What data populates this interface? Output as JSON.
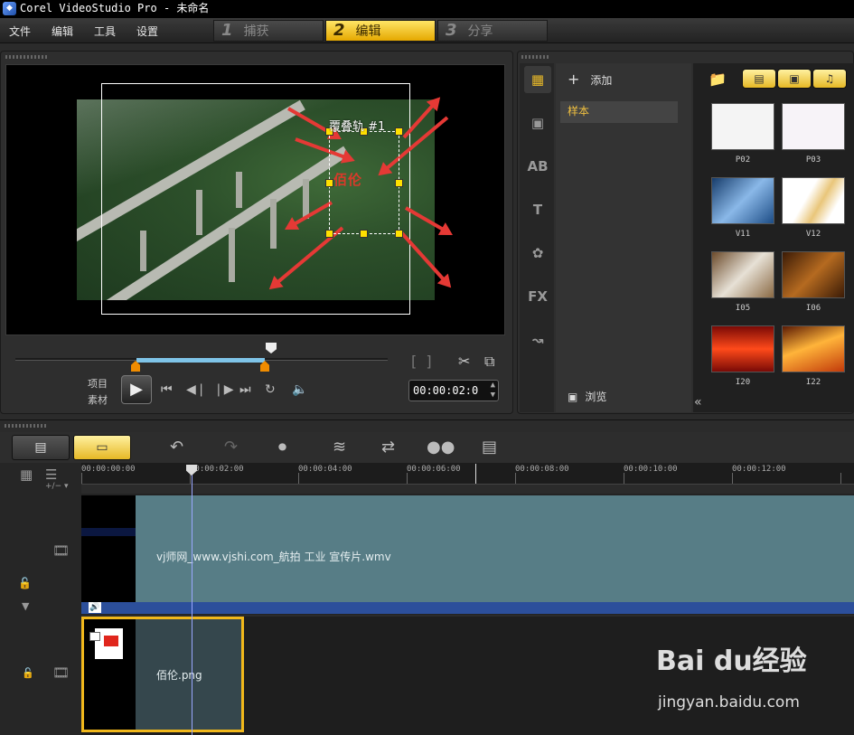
{
  "window": {
    "title": "Corel VideoStudio Pro - 未命名"
  },
  "menu": {
    "items": [
      "文件",
      "编辑",
      "工具",
      "设置"
    ]
  },
  "steps": [
    {
      "num": "1",
      "label": "捕获"
    },
    {
      "num": "2",
      "label": "编辑",
      "active": true
    },
    {
      "num": "3",
      "label": "分享"
    }
  ],
  "preview": {
    "overlay_label": "覆叠轨 #1",
    "overlay_logo_text": "佰伦",
    "mode_labels": [
      "项目",
      "素材"
    ],
    "timecode": "00:00:02:0"
  },
  "library": {
    "add_label": "添加",
    "folder": "样本",
    "browse_label": "浏览",
    "tabs": [
      "media",
      "transition",
      "AB",
      "T",
      "graphic",
      "FX",
      "path"
    ],
    "thumbs": [
      {
        "label": "P02",
        "color": "#f4f4f4"
      },
      {
        "label": "P03",
        "color": "#f7f3f8"
      },
      {
        "label": "V11",
        "color": "#3a6fa6"
      },
      {
        "label": "V12",
        "color": "#f5ecd8"
      },
      {
        "label": "I05",
        "color": "#b58c62"
      },
      {
        "label": "I06",
        "color": "#8a4a18"
      },
      {
        "label": "I20",
        "color": "#c2201a"
      },
      {
        "label": "I22",
        "color": "#e08a1a"
      }
    ]
  },
  "timeline": {
    "ticks": [
      "00:00:00:00",
      "00:00:02:00",
      "00:00:04:00",
      "00:00:06:00",
      "00:00:08:00",
      "00:00:10:00",
      "00:00:12:00"
    ],
    "video_clip_name": "vj师网_www.vjshi.com_航拍 工业 宣传片.wmv",
    "overlay_clip_name": "佰伦.png"
  },
  "watermark": {
    "text": "Bai du经验",
    "url": "jingyan.baidu.com"
  }
}
